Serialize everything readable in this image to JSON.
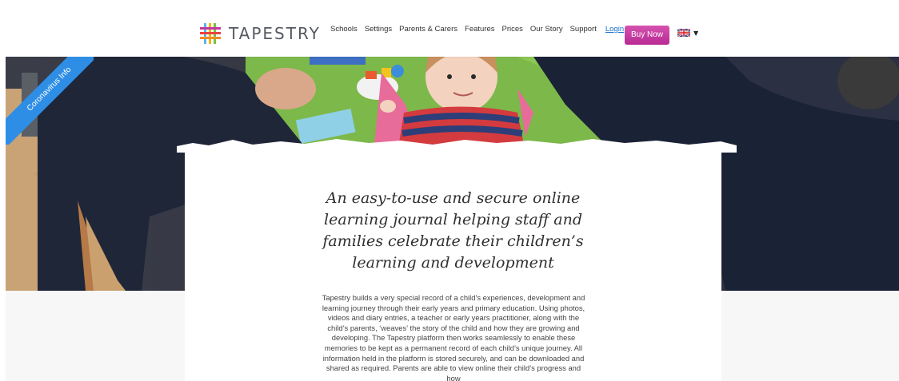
{
  "ribbon": {
    "label": "Coronavirus Info"
  },
  "brand": {
    "name": "TAPESTRY",
    "accent": "#c13a9f",
    "ribbon_color": "#2e8ee6"
  },
  "nav": {
    "items": [
      "Schools",
      "Settings",
      "Parents & Carers",
      "Features",
      "Prices",
      "Our Story",
      "Support"
    ],
    "login": "Login",
    "buy_now": "Buy Now",
    "language_icon": "uk-flag-icon"
  },
  "hero": {
    "headline_lines": [
      "An easy-to-use and secure online",
      "learning journal helping staff and",
      "families celebrate their children’s",
      "learning and development"
    ],
    "body_lines": [
      "Tapestry builds a very special record of a child’s experiences, development and",
      "learning journey through their early years and primary education. Using photos,",
      "videos and diary entries, a teacher or early years practitioner, along with the",
      "child’s parents, ‘weaves’ the story of the child and how they are growing and",
      "developing. The Tapestry platform then works seamlessly to enable these",
      "memories to be kept as a permanent record of each child’s unique journey. All",
      "information held in the platform is stored securely, and can be downloaded and",
      "shared as required. Parents are able to view online their child’s progress and how"
    ]
  }
}
